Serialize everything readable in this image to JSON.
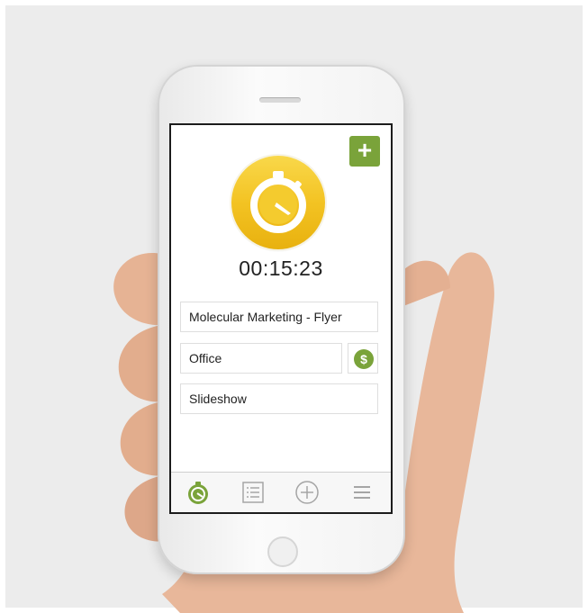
{
  "timer": {
    "elapsed": "00:15:23"
  },
  "fields": {
    "project": "Molecular Marketing - Flyer",
    "client": "Office",
    "task": "Slideshow"
  },
  "icons": {
    "add": "plus-icon",
    "timer": "stopwatch-icon",
    "billable": "dollar-icon",
    "tabs": [
      "stopwatch-icon",
      "list-icon",
      "add-circle-icon",
      "menu-icon"
    ]
  },
  "colors": {
    "accent": "#7aa33a",
    "timer_yellow": "#f3c323"
  },
  "active_tab": "stopwatch-icon"
}
